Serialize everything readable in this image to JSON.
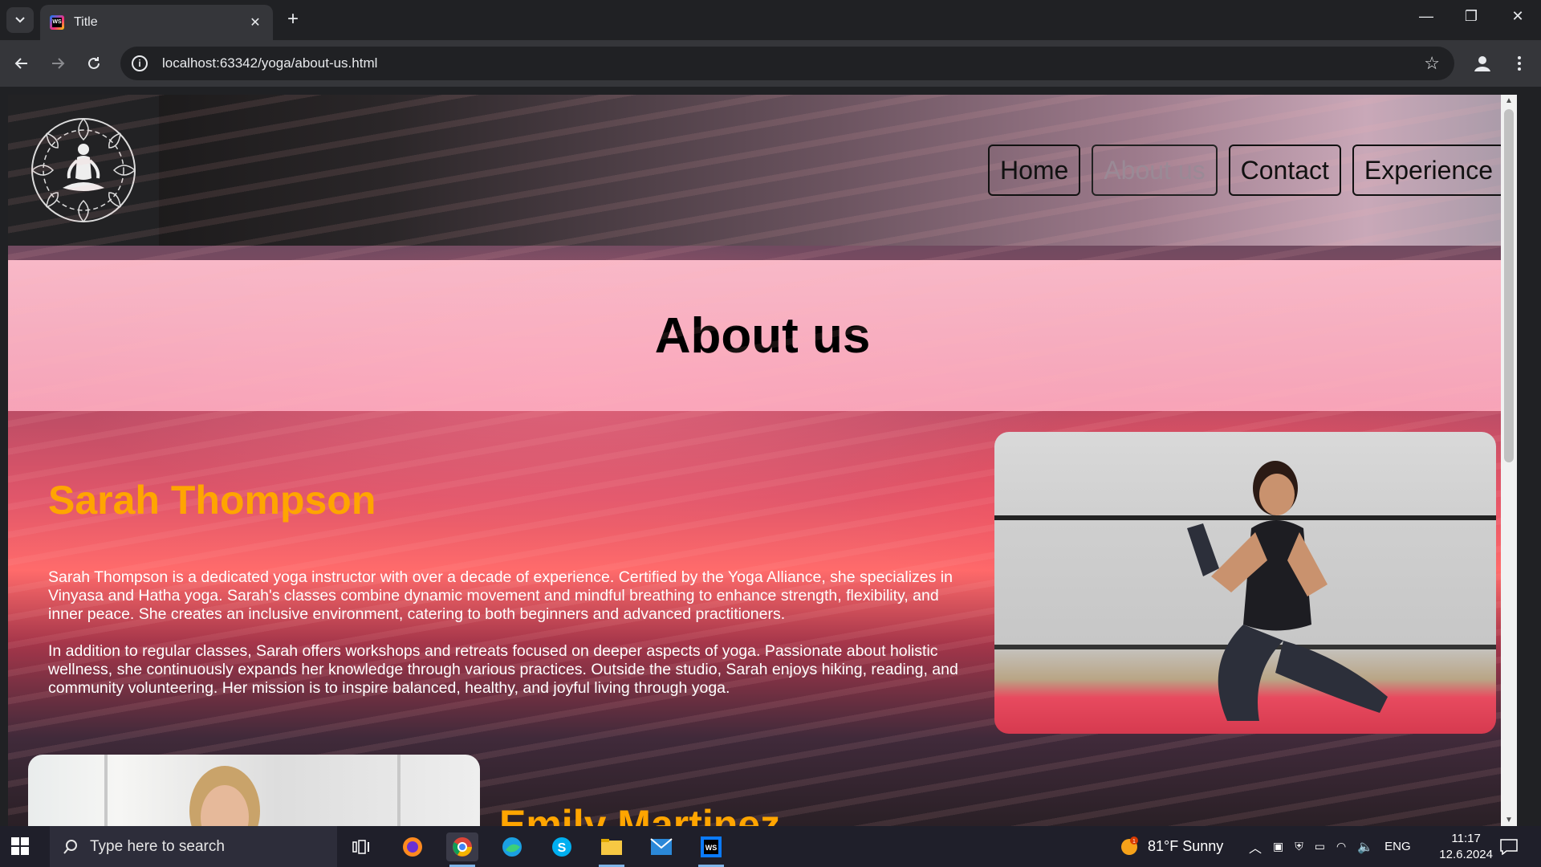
{
  "browser": {
    "tab_title": "Title",
    "tab_close": "✕",
    "new_tab": "+",
    "url": "localhost:63342/yoga/about-us.html",
    "window_controls": {
      "minimize": "—",
      "restore": "❐",
      "close": "✕"
    }
  },
  "site": {
    "nav": {
      "items": [
        {
          "label": "Home",
          "active": false
        },
        {
          "label": "About us",
          "active": true
        },
        {
          "label": "Contact",
          "active": false
        },
        {
          "label": "Experience",
          "active": false
        }
      ]
    },
    "hero_title": "About us",
    "profiles": [
      {
        "name": "Sarah Thompson",
        "paragraphs": [
          "Sarah Thompson is a dedicated yoga instructor with over a decade of experience. Certified by the Yoga Alliance, she specializes in Vinyasa and Hatha yoga. Sarah's classes combine dynamic movement and mindful breathing to enhance strength, flexibility, and inner peace. She creates an inclusive environment, catering to both beginners and advanced practitioners.",
          "In addition to regular classes, Sarah offers workshops and retreats focused on deeper aspects of yoga. Passionate about holistic wellness, she continuously expands her knowledge through various practices. Outside the studio, Sarah enjoys hiking, reading, and community volunteering. Her mission is to inspire balanced, healthy, and joyful living through yoga."
        ]
      },
      {
        "name": "Emily Martinez"
      }
    ],
    "accent_color": "#ffa500"
  },
  "taskbar": {
    "search_placeholder": "Type here to search",
    "weather": "81°F  Sunny",
    "language": "ENG",
    "time": "11:17",
    "date": "12.6.2024",
    "weather_badge": "1"
  }
}
